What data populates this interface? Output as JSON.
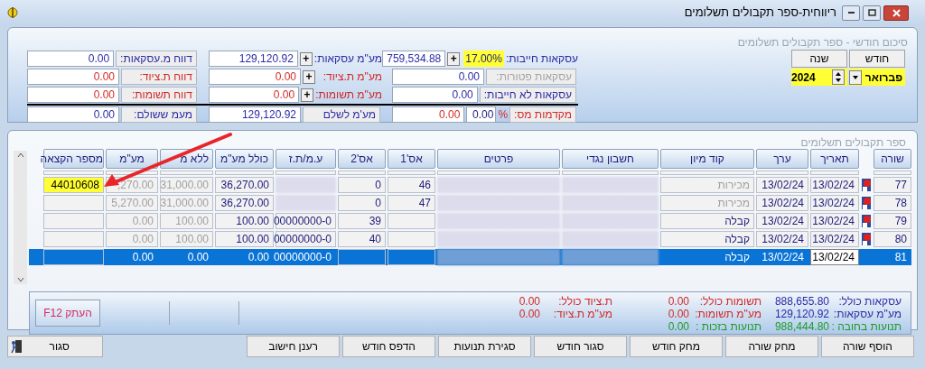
{
  "window": {
    "title": "ריווחית-ספר תקבולים תשלומים"
  },
  "summary": {
    "title": "סיכום חודשי - ספר תקבולים תשלומים",
    "month": {
      "label": "חודש",
      "value": "פברואר"
    },
    "year": {
      "label": "שנה",
      "value": "2024"
    },
    "rows": [
      [
        {
          "kind": "rate",
          "label": "עסקאות חייבות:",
          "rate": "17.00%",
          "button": "+",
          "value": "759,534.88",
          "color": "#2b2ba6"
        },
        {
          "kind": "plus",
          "label": "מע\"מ עסקאות:",
          "button": "+",
          "value": "129,120.92",
          "color": "#2b2ba6"
        },
        {
          "kind": "box",
          "label": "דווח מ.עסקאות:",
          "value": "0.00",
          "color": "#2b2ba6"
        }
      ],
      [
        {
          "kind": "box",
          "label": "עסקאות פטורות:",
          "value": "0.00",
          "disabled": true,
          "color": "#2b2ba6"
        },
        {
          "kind": "plus",
          "label": "מע\"מ ת.ציוד:",
          "button": "+",
          "value": "0.00",
          "color": "#d42828"
        },
        {
          "kind": "box",
          "label": "דווח ת.ציוד:",
          "value": "0.00",
          "color": "#d42828"
        }
      ],
      [
        {
          "kind": "box",
          "label": "עסקאות לא חייבות:",
          "value": "0.00",
          "color": "#2b2ba6"
        },
        {
          "kind": "plus",
          "label": "מע\"מ תשומות:",
          "button": "+",
          "value": "0.00",
          "color": "#d42828"
        },
        {
          "kind": "box",
          "label": "דווח תשומות:",
          "value": "0.00",
          "color": "#d42828"
        }
      ],
      [
        {
          "kind": "percent",
          "label": "מקדמות מס:",
          "sign": "%",
          "rate": "0.00",
          "value": "0.00",
          "color": "#d42828"
        },
        {
          "kind": "box",
          "label": "מע'מ לשלם",
          "value": "129,120.92",
          "color": "#2b2ba6"
        },
        {
          "kind": "box",
          "label": "מעמ ששולם:",
          "value": "0.00",
          "color": "#2b2ba6"
        }
      ]
    ]
  },
  "ledger": {
    "title": "ספר תקבולים תשלומים",
    "columns": [
      "שורה",
      "תאריך",
      "ערך",
      "קוד מיון",
      "חשבון נגדי",
      "פרטים",
      "אס'1",
      "אס'2",
      "ע.מ/ת.ז",
      "כולל מע\"מ",
      "ללא מ",
      "מע\"מ",
      "מספר הקצאה"
    ],
    "rows": [
      {
        "selected": false,
        "flagged": true,
        "cells": [
          "77",
          "13/02/24",
          "13/02/24",
          {
            "text": "מכירות",
            "dimmed": true
          },
          {
            "blurred": true
          },
          {
            "blurred": true
          },
          "46",
          "0",
          {
            "blurred": true
          },
          "36,270.00",
          {
            "text": "31,000.00",
            "dimmed": true
          },
          {
            "text": ",270.00",
            "dimmed": true
          },
          {
            "text": "44010608",
            "highlighted": true
          }
        ]
      },
      {
        "selected": false,
        "flagged": true,
        "cells": [
          "78",
          "13/02/24",
          "13/02/24",
          {
            "text": "מכירות",
            "dimmed": true
          },
          {
            "blurred": true
          },
          {
            "blurred": true
          },
          "47",
          "0",
          {
            "blurred": true
          },
          "36,270.00",
          {
            "text": "31,000.00",
            "dimmed": true
          },
          {
            "text": "5,270.00",
            "dimmed": true
          },
          null
        ]
      },
      {
        "selected": false,
        "flagged": true,
        "cells": [
          "79",
          "13/02/24",
          "13/02/24",
          "קבלה",
          {
            "blurred": true
          },
          {
            "blurred": true
          },
          null,
          "39",
          "00000000-0",
          "100.00",
          {
            "text": "100.00",
            "dimmed": true
          },
          {
            "text": "0.00",
            "dimmed": true
          },
          null
        ]
      },
      {
        "selected": false,
        "flagged": true,
        "cells": [
          "80",
          "13/02/24",
          "13/02/24",
          "קבלה",
          {
            "blurred": true
          },
          {
            "blurred": true
          },
          null,
          "40",
          "00000000-0",
          "100.00",
          {
            "text": "100.00",
            "dimmed": true
          },
          {
            "text": "0.00",
            "dimmed": true
          },
          null
        ]
      },
      {
        "selected": true,
        "flagged": false,
        "cells": [
          "81",
          {
            "text": "13/02/24",
            "editing": true
          },
          "13/02/24",
          "קבלה",
          {
            "blurred": true
          },
          {
            "blurred": true
          },
          null,
          null,
          "00000000-0",
          "0.00",
          "0.00",
          "0.00",
          null
        ]
      }
    ],
    "copy_button": "העתק F12",
    "totals": [
      [
        {
          "label": "עסקאות כולל:",
          "value": "888,655.80",
          "color": "#2b2ba6"
        },
        {
          "label": "מע\"מ עסקאות:",
          "value": "129,120.92",
          "color": "#2b2ba6"
        },
        {
          "label": "תנועות בחובה :",
          "value": "988,444.80",
          "color": "#1e9a2a"
        }
      ],
      [
        {
          "label": "תשומות כולל:",
          "value": "0.00",
          "color": "#d42828"
        },
        {
          "label": "מע\"מ תשומות:",
          "value": "0.00",
          "color": "#d42828"
        },
        {
          "label": "תנועות בזכות :",
          "value": "0.00",
          "color": "#1e9a2a"
        }
      ],
      [
        {
          "label": "ת.ציוד כולל:",
          "value": "0.00",
          "color": "#d42828"
        },
        {
          "label": "מע\"מ ת.ציוד:",
          "value": "0.00",
          "color": "#d42828"
        }
      ]
    ]
  },
  "buttons": [
    "הוסף שורה",
    "מחק שורה",
    "מחק חודש",
    "סגור חודש",
    "סגירת תנועות",
    "הדפס חודש",
    "רענן חישוב"
  ],
  "close_button": "סגור"
}
